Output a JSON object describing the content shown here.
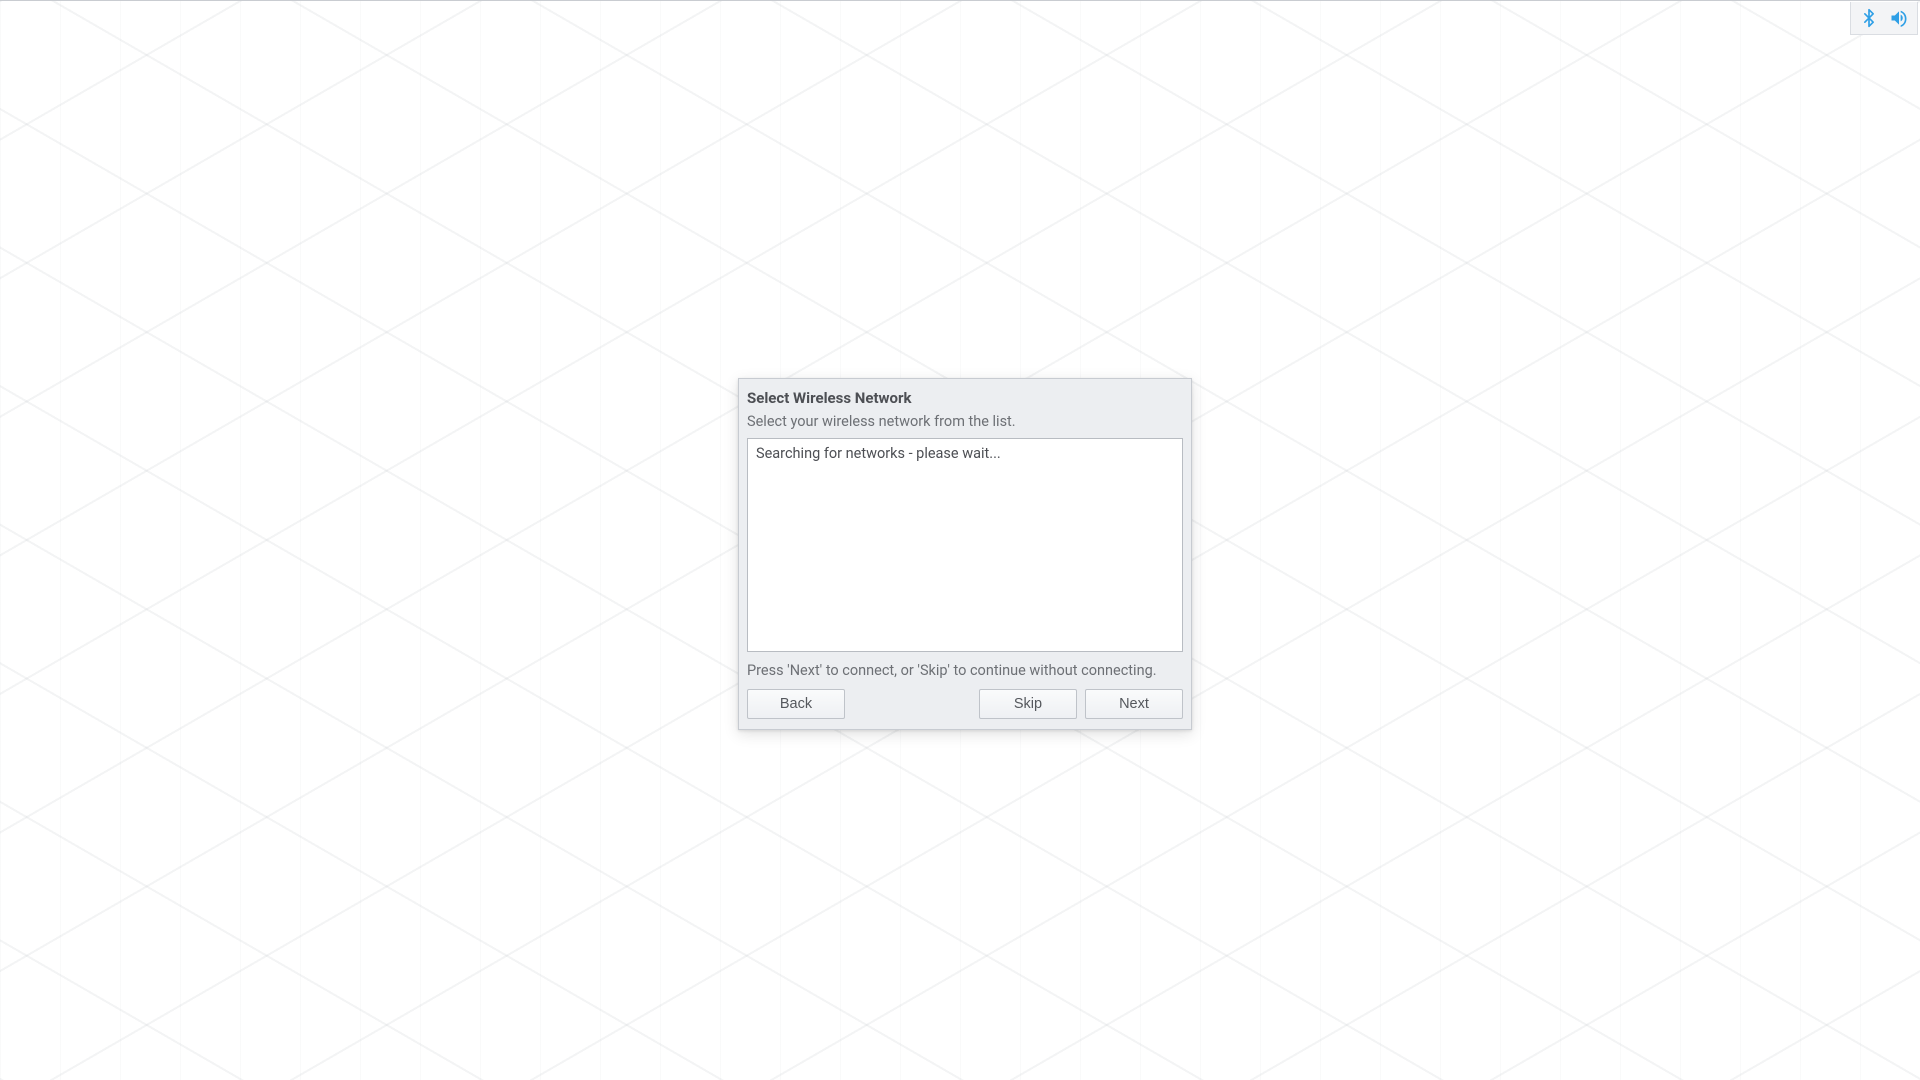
{
  "tray": {
    "bluetooth_icon": "bluetooth-icon",
    "volume_icon": "volume-icon"
  },
  "dialog": {
    "title": "Select Wireless Network",
    "subtitle": "Select your wireless network from the list.",
    "list_status": "Searching for networks - please wait...",
    "hint": "Press 'Next' to connect, or 'Skip' to continue without connecting.",
    "buttons": {
      "back": "Back",
      "skip": "Skip",
      "next": "Next"
    }
  },
  "colors": {
    "accent": "#2e9fe6"
  }
}
